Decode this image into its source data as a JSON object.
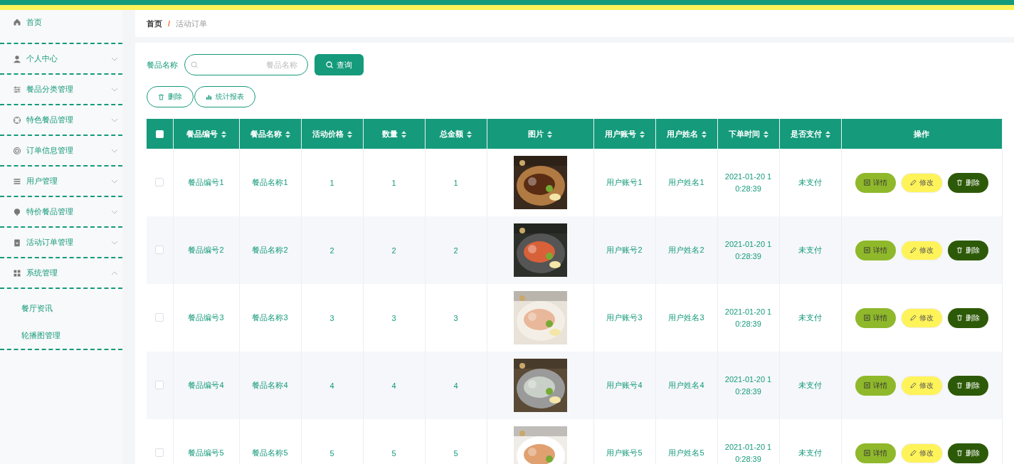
{
  "sidebar": {
    "items": [
      {
        "kind": "link",
        "label": "首页"
      },
      {
        "kind": "menu",
        "label": "个人中心",
        "expanded": false
      },
      {
        "kind": "menu",
        "label": "餐品分类管理",
        "expanded": false
      },
      {
        "kind": "menu",
        "label": "特色餐品管理",
        "expanded": false
      },
      {
        "kind": "menu",
        "label": "订单信息管理",
        "expanded": false
      },
      {
        "kind": "menu",
        "label": "用户管理",
        "expanded": false
      },
      {
        "kind": "menu",
        "label": "特价餐品管理",
        "expanded": false
      },
      {
        "kind": "menu",
        "label": "活动订单管理",
        "expanded": false
      },
      {
        "kind": "menu",
        "label": "系统管理",
        "expanded": true,
        "children": [
          {
            "label": "餐厅资讯"
          },
          {
            "label": "轮播图管理"
          }
        ]
      }
    ]
  },
  "breadcrumb": [
    "首页",
    "/",
    "活动订单"
  ],
  "search": {
    "label": "餐品名称",
    "placeholder": "餐品名称",
    "button": "查询"
  },
  "actions": [
    "删除",
    "统计报表"
  ],
  "table": {
    "header_checkbox": {
      "checked": false
    },
    "columns": [
      {
        "label": "餐品编号",
        "sortable": true
      },
      {
        "label": "餐品名称",
        "sortable": true
      },
      {
        "label": "活动价格",
        "sortable": true
      },
      {
        "label": "数量",
        "sortable": true
      },
      {
        "label": "总金额",
        "sortable": true
      },
      {
        "label": "图片",
        "sortable": true
      },
      {
        "label": "用户账号",
        "sortable": true
      },
      {
        "label": "用户姓名",
        "sortable": true
      },
      {
        "label": "下单时间",
        "sortable": true
      },
      {
        "label": "是否支付",
        "sortable": true
      },
      {
        "label": "操作",
        "sortable": false
      }
    ],
    "rows": [
      {
        "checked": false,
        "cells": [
          "餐品编号1",
          "餐品名称1",
          "1",
          "1",
          "1",
          {
            "kind": "picture"
          },
          "用户账号1",
          "用户姓名1",
          "2021-01-20 10:28:39",
          "未支付"
        ],
        "buttons": [
          "详情",
          "修改",
          "删除"
        ]
      },
      {
        "checked": false,
        "cells": [
          "餐品编号2",
          "餐品名称2",
          "2",
          "2",
          "2",
          {
            "kind": "picture"
          },
          "用户账号2",
          "用户姓名2",
          "2021-01-20 10:28:39",
          "未支付"
        ],
        "buttons": [
          "详情",
          "修改",
          "删除"
        ]
      },
      {
        "checked": false,
        "cells": [
          "餐品编号3",
          "餐品名称3",
          "3",
          "3",
          "3",
          {
            "kind": "picture"
          },
          "用户账号3",
          "用户姓名3",
          "2021-01-20 10:28:39",
          "未支付"
        ],
        "buttons": [
          "详情",
          "修改",
          "删除"
        ]
      },
      {
        "checked": false,
        "cells": [
          "餐品编号4",
          "餐品名称4",
          "4",
          "4",
          "4",
          {
            "kind": "picture"
          },
          "用户账号4",
          "用户姓名4",
          "2021-01-20 10:28:39",
          "未支付"
        ],
        "buttons": [
          "详情",
          "修改",
          "删除"
        ]
      },
      {
        "checked": false,
        "cells": [
          "餐品编号5",
          "餐品名称5",
          "5",
          "5",
          "5",
          {
            "kind": "picture"
          },
          "用户账号5",
          "用户姓名5",
          "2021-01-20 10:28:39",
          "未支付"
        ],
        "buttons": [
          "详情",
          "修改",
          "删除"
        ]
      }
    ]
  }
}
